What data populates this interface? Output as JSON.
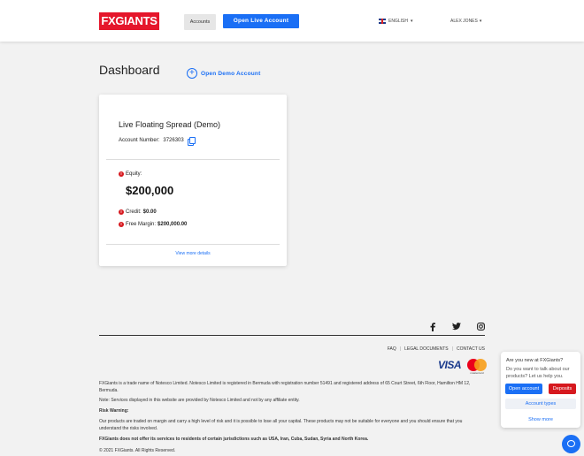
{
  "header": {
    "logo": "FXGIANTS",
    "accounts_label": "Accounts",
    "open_live_label": "Open Live Account",
    "language": "ENGLISH",
    "user": "ALEX JONES"
  },
  "main": {
    "title": "Dashboard",
    "open_demo_label": "Open Demo Account",
    "card": {
      "title": "Live Floating Spread (Demo)",
      "account_number_label": "Account Number:",
      "account_number": "3726303",
      "equity_label": "Equity:",
      "equity_value": "$200,000",
      "credit_label": "Credit:",
      "credit_value": "$0.00",
      "free_margin_label": "Free Margin:",
      "free_margin_value": "$200,000.00",
      "view_more": "View more details"
    }
  },
  "footer": {
    "links": [
      "FAQ",
      "LEGAL DOCUMENTS",
      "CONTACT US"
    ],
    "visa": "VISA",
    "mastercard": "mastercard",
    "para1": "FXGiants is a trade name of Notesco Limited. Notesco Limited is registered in Bermuda with registration number 51491 and registered address of 65 Court Street, 6th Floor, Hamilton HM 12, Bermuda.",
    "para2": "Note: Services displayed in this website are provided by Notesco Limited and not by any affiliate entity.",
    "risk_heading": "Risk Warning:",
    "risk_text": "Our products are traded on margin and carry a high level of risk and it is possible to lose all your capital. These products may not be suitable for everyone and you should ensure that you understand the risks involved.",
    "restriction": "FXGiants does not offer its services to residents of certain jurisdictions such as USA, Iran, Cuba, Sudan, Syria and North Korea.",
    "copyright": "© 2021 FXGiants. All Rights Reserved."
  },
  "chat": {
    "question1": "Are you new at FXGiants?",
    "question2": "Do you want to talk about our products? Let us help you.",
    "open_account": "Open account",
    "deposits": "Deposits",
    "account_types": "Account types",
    "show_more": "Show more"
  },
  "icons": {
    "social": [
      "facebook-icon",
      "twitter-icon",
      "instagram-icon"
    ]
  },
  "colors": {
    "brand_red": "#e5162b",
    "accent_blue": "#1a6ff5"
  }
}
